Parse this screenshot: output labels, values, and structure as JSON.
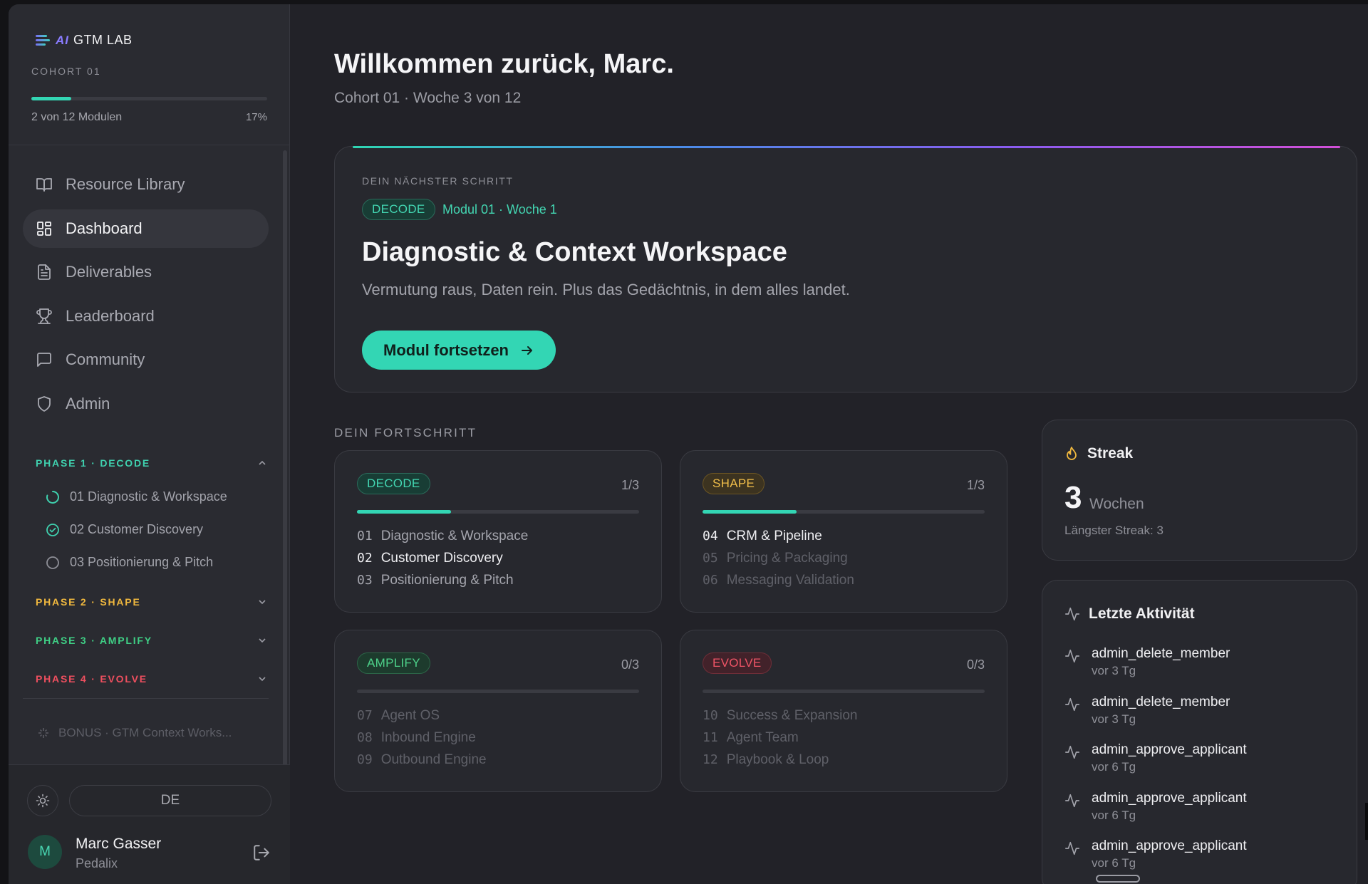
{
  "app": {
    "logo_ai": "AI",
    "logo_text": "GTM LAB",
    "cohort": "COHORT 01",
    "progress_fraction": 0.17,
    "progress_label": "2 von 12 Modulen",
    "progress_pct": "17%"
  },
  "nav": [
    {
      "label": "Resource Library",
      "icon": "book-icon",
      "active": false
    },
    {
      "label": "Dashboard",
      "icon": "grid-icon",
      "active": true
    },
    {
      "label": "Deliverables",
      "icon": "document-icon",
      "active": false
    },
    {
      "label": "Leaderboard",
      "icon": "trophy-icon",
      "active": false
    },
    {
      "label": "Community",
      "icon": "chat-icon",
      "active": false
    },
    {
      "label": "Admin",
      "icon": "shield-icon",
      "active": false
    }
  ],
  "phases": [
    {
      "label": "PHASE 1 · DECODE",
      "color": "#3fd0ae",
      "expanded": true,
      "items": [
        {
          "label": "01 Diagnostic & Workspace",
          "status": "in-progress"
        },
        {
          "label": "02 Customer Discovery",
          "status": "done"
        },
        {
          "label": "03 Positionierung & Pitch",
          "status": "open"
        }
      ]
    },
    {
      "label": "PHASE 2 · SHAPE",
      "color": "#f0b83e",
      "expanded": false
    },
    {
      "label": "PHASE 3 · AMPLIFY",
      "color": "#3fcf85",
      "expanded": false
    },
    {
      "label": "PHASE 4 · EVOLVE",
      "color": "#ef4f5f",
      "expanded": false
    }
  ],
  "bonus": "BONUS · GTM Context Works...",
  "footer": {
    "language": "DE",
    "avatar_initial": "M",
    "user_name": "Marc Gasser",
    "user_org": "Pedalix"
  },
  "header": {
    "title": "Willkommen zurück, Marc.",
    "subtitle": "Cohort 01 · Woche 3 von 12"
  },
  "hero": {
    "kicker": "DEIN NÄCHSTER SCHRITT",
    "tag": "DECODE",
    "meta": "Modul 01 · Woche 1",
    "title": "Diagnostic & Context Workspace",
    "description": "Vermutung raus, Daten rein. Plus das Gedächtnis, in dem alles landet.",
    "button": "Modul fortsetzen"
  },
  "progress_section": {
    "label": "DEIN FORTSCHRITT",
    "cards": [
      {
        "tag": "DECODE",
        "count": "1/3",
        "fraction": 0.333,
        "items": [
          {
            "num": "01",
            "label": "Diagnostic & Workspace",
            "state": "mid"
          },
          {
            "num": "02",
            "label": "Customer Discovery",
            "state": "bright"
          },
          {
            "num": "03",
            "label": "Positionierung & Pitch",
            "state": "mid"
          }
        ]
      },
      {
        "tag": "SHAPE",
        "count": "1/3",
        "fraction": 0.333,
        "items": [
          {
            "num": "04",
            "label": "CRM & Pipeline",
            "state": "bright"
          },
          {
            "num": "05",
            "label": "Pricing & Packaging",
            "state": "dim"
          },
          {
            "num": "06",
            "label": "Messaging Validation",
            "state": "dim"
          }
        ]
      },
      {
        "tag": "AMPLIFY",
        "count": "0/3",
        "fraction": 0,
        "items": [
          {
            "num": "07",
            "label": "Agent OS",
            "state": "dim"
          },
          {
            "num": "08",
            "label": "Inbound Engine",
            "state": "dim"
          },
          {
            "num": "09",
            "label": "Outbound Engine",
            "state": "dim"
          }
        ]
      },
      {
        "tag": "EVOLVE",
        "count": "0/3",
        "fraction": 0,
        "items": [
          {
            "num": "10",
            "label": "Success & Expansion",
            "state": "dim"
          },
          {
            "num": "11",
            "label": "Agent Team",
            "state": "dim"
          },
          {
            "num": "12",
            "label": "Playbook & Loop",
            "state": "dim"
          }
        ]
      }
    ]
  },
  "streak": {
    "title": "Streak",
    "value": "3",
    "unit": "Wochen",
    "best": "Längster Streak: 3"
  },
  "activity": {
    "title": "Letzte Aktivität",
    "items": [
      {
        "name": "admin_delete_member",
        "time": "vor 3 Tg"
      },
      {
        "name": "admin_delete_member",
        "time": "vor 3 Tg"
      },
      {
        "name": "admin_approve_applicant",
        "time": "vor 6 Tg"
      },
      {
        "name": "admin_approve_applicant",
        "time": "vor 6 Tg"
      },
      {
        "name": "admin_approve_applicant",
        "time": "vor 6 Tg"
      }
    ]
  },
  "colors": {
    "accent": "#33d6b4",
    "background": "#222228",
    "card": "#27282e"
  }
}
